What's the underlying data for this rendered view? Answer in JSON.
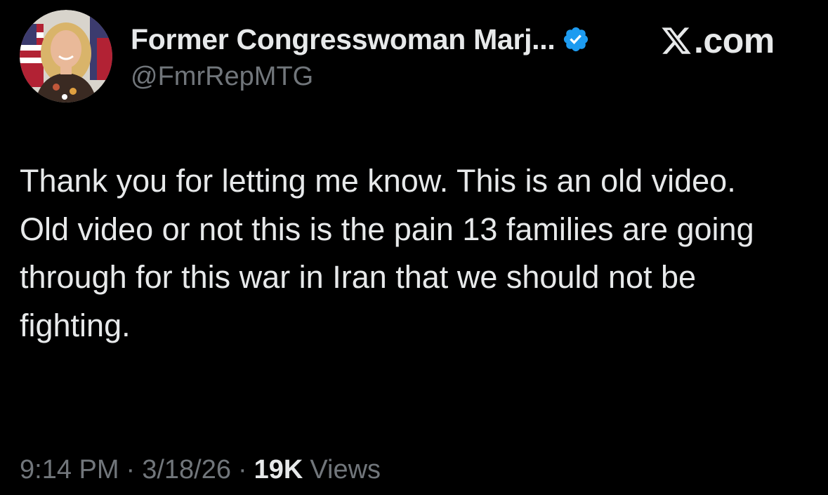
{
  "author": {
    "display_name": "Former Congresswoman Marj...",
    "handle": "@FmrRepMTG",
    "verified": true,
    "badge_color": "#1d9bf0"
  },
  "brand": {
    "label": ".com",
    "icon": "x-logo-icon"
  },
  "tweet": {
    "lines": [
      "Thank you for letting me know. This is an old video.",
      "Old video or not this is the pain 13 families are going through for this war in Iran that we should not be fighting."
    ]
  },
  "meta": {
    "time": "9:14 PM",
    "date": "3/18/26",
    "views_count": "19K",
    "views_label": "Views",
    "separator": "·"
  },
  "colors": {
    "background": "#000000",
    "primary_text": "#e7e9ea",
    "secondary_text": "#71767b",
    "verified": "#1d9bf0"
  }
}
